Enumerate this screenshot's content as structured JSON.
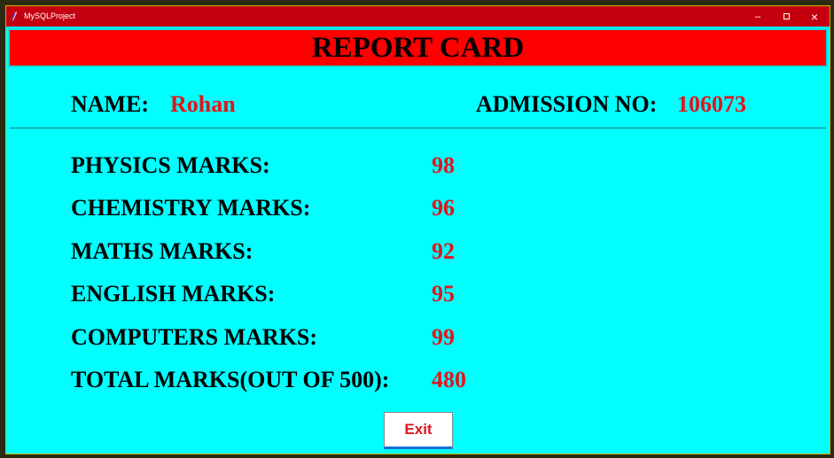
{
  "window": {
    "title": "MySQLProject",
    "controls": {
      "minimize": "–",
      "close": "×"
    }
  },
  "header": {
    "title": "REPORT CARD"
  },
  "student": {
    "name_label": "NAME:",
    "name_value": "Rohan",
    "admission_label": "ADMISSION NO:",
    "admission_value": "106073"
  },
  "marks": [
    {
      "label": "PHYSICS MARKS:",
      "value": "98"
    },
    {
      "label": "CHEMISTRY MARKS:",
      "value": "96"
    },
    {
      "label": "MATHS MARKS:",
      "value": "92"
    },
    {
      "label": "ENGLISH MARKS:",
      "value": "95"
    },
    {
      "label": "COMPUTERS MARKS:",
      "value": "99"
    },
    {
      "label": "TOTAL MARKS(OUT OF 500):",
      "value": "480"
    }
  ],
  "exit_label": "Exit",
  "colors": {
    "background": "#00ffff",
    "banner": "#ff0000",
    "value_text": "#e0161b",
    "titlebar": "#c40010"
  }
}
